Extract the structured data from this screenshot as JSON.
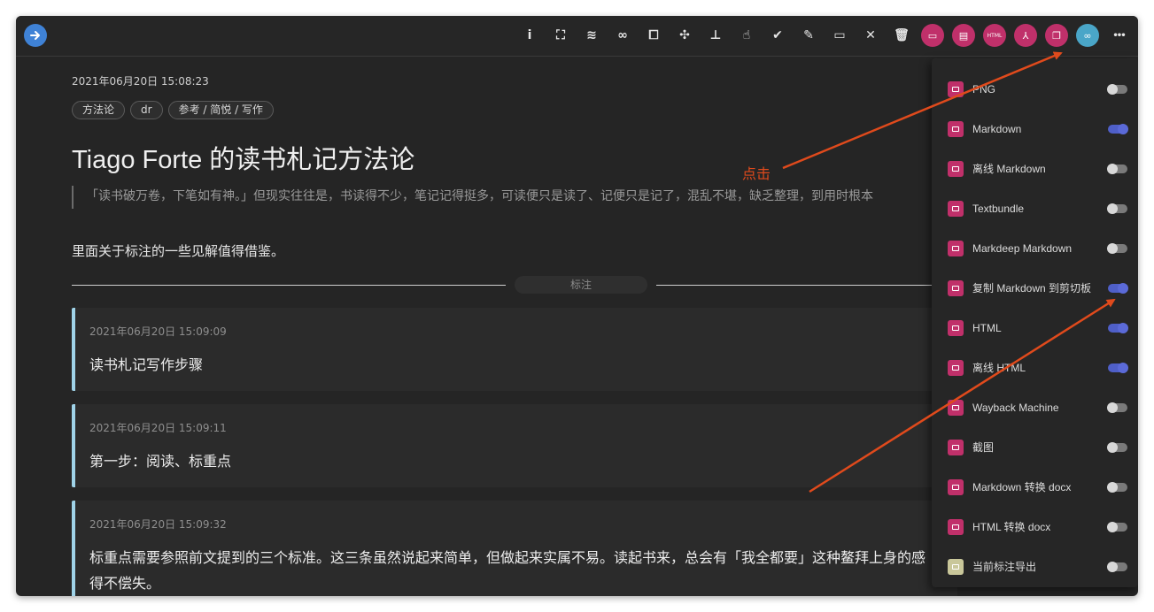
{
  "toolbar": {
    "back_icon": "arrow-right-icon",
    "icons": [
      {
        "name": "info-icon",
        "glyph": "i"
      },
      {
        "name": "fullscreen-icon",
        "glyph": "⛶"
      },
      {
        "name": "layers-icon",
        "glyph": "≋"
      },
      {
        "name": "link-icon",
        "glyph": "∞"
      },
      {
        "name": "crop-icon",
        "glyph": "⧠"
      },
      {
        "name": "hub-icon",
        "glyph": "✣"
      },
      {
        "name": "sitemap-icon",
        "glyph": "⊥"
      },
      {
        "name": "hand-pointer-icon",
        "glyph": "☝"
      },
      {
        "name": "double-check-icon",
        "glyph": "✔"
      },
      {
        "name": "pencil-icon",
        "glyph": "✎"
      },
      {
        "name": "archive-icon",
        "glyph": "▭"
      },
      {
        "name": "close-icon",
        "glyph": "✕"
      },
      {
        "name": "trash-icon",
        "glyph": "🗑"
      }
    ],
    "round_icons": [
      {
        "name": "markdown-export-icon",
        "glyph": "▭",
        "color": "#c0306a"
      },
      {
        "name": "textbundle-export-icon",
        "glyph": "▤",
        "color": "#c0306a"
      },
      {
        "name": "html-export-icon",
        "glyph": "HTML",
        "color": "#c0306a"
      },
      {
        "name": "pdf-export-icon",
        "glyph": "⅄",
        "color": "#c0306a"
      },
      {
        "name": "copy-export-icon",
        "glyph": "❐",
        "color": "#c0306a"
      },
      {
        "name": "share-link-icon",
        "glyph": "∞",
        "color": "#4aa6c8"
      }
    ],
    "more_icon": "more-horizontal-icon"
  },
  "document": {
    "date": "2021年06月20日 15:08:23",
    "tags": [
      "方法论",
      "dr",
      "参考 / 简悦 / 写作"
    ],
    "title": "Tiago Forte 的读书札记方法论",
    "quote": "「读书破万卷，下笔如有神。」但现实往往是，书读得不少，笔记记得挺多，可读便只是读了、记便只是记了，混乱不堪，缺乏整理，到用时根本",
    "paragraph": "里面关于标注的一些见解值得借鉴。",
    "divider_label": "标注",
    "annotations": [
      {
        "date": "2021年06月20日 15:09:09",
        "lines": [
          "读书札记写作步骤"
        ]
      },
      {
        "date": "2021年06月20日 15:09:11",
        "lines": [
          "第一步：阅读、标重点"
        ]
      },
      {
        "date": "2021年06月20日 15:09:32",
        "lines": [
          "标重点需要参照前文提到的三个标准。这三条虽然说起来简单，但做起来实属不易。读起书来，总会有「我全都要」这种鳌拜上身的感",
          "得不偿失。"
        ]
      }
    ]
  },
  "export_menu": {
    "items": [
      {
        "label": "PNG",
        "icon": "image-icon",
        "on": false,
        "color": "#c0306a"
      },
      {
        "label": "Markdown",
        "icon": "markdown-icon",
        "on": true,
        "color": "#c0306a"
      },
      {
        "label": "离线 Markdown",
        "icon": "offline-markdown-icon",
        "on": false,
        "color": "#c0306a"
      },
      {
        "label": "Textbundle",
        "icon": "textbundle-icon",
        "on": false,
        "color": "#c0306a"
      },
      {
        "label": "Markdeep Markdown",
        "icon": "markdeep-icon",
        "on": false,
        "color": "#c0306a"
      },
      {
        "label": "复制 Markdown 到剪切板",
        "icon": "copy-icon",
        "on": true,
        "color": "#c0306a"
      },
      {
        "label": "HTML",
        "icon": "html-icon",
        "on": true,
        "color": "#c0306a"
      },
      {
        "label": "离线 HTML",
        "icon": "offline-html-icon",
        "on": true,
        "color": "#c0306a"
      },
      {
        "label": "Wayback Machine",
        "icon": "wayback-icon",
        "on": false,
        "color": "#c0306a"
      },
      {
        "label": "截图",
        "icon": "scissors-icon",
        "on": false,
        "color": "#c0306a"
      },
      {
        "label": "Markdown 转换 docx",
        "icon": "word-icon",
        "on": false,
        "color": "#c0306a"
      },
      {
        "label": "HTML 转换 docx",
        "icon": "cloud-upload-icon",
        "on": false,
        "color": "#c0306a"
      },
      {
        "label": "当前标注导出",
        "icon": "highlighter-icon",
        "on": false,
        "color": "#c9c79a"
      }
    ]
  },
  "callout": {
    "text": "点击",
    "color": "#e04a1c"
  }
}
